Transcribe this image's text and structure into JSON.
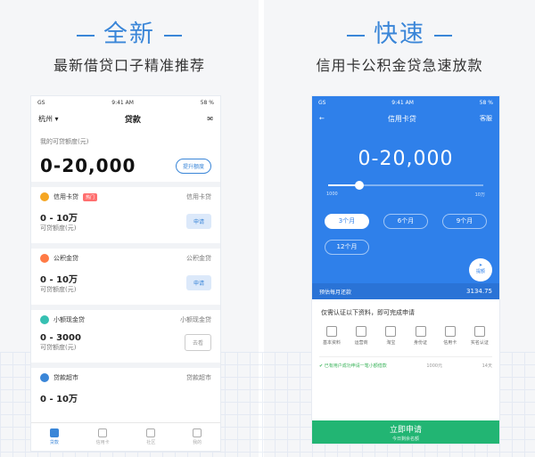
{
  "left": {
    "headline": "全新",
    "subline": "最新借贷口子精准推荐",
    "status": {
      "carrier": "GS",
      "time": "9:41 AM",
      "battery": "58 %"
    },
    "nav": {
      "city": "杭州",
      "title": "贷款"
    },
    "quota_label": "我的可贷额度(元)",
    "amount": "0-20,000",
    "boost_btn": "提升额度",
    "cards": [
      {
        "name": "信用卡贷",
        "badge": "热门",
        "right": "信用卡贷",
        "amount": "0 - 10万",
        "sub": "可贷额度(元)",
        "btn": "申请",
        "icon_color": "#f5a623"
      },
      {
        "name": "公积金贷",
        "badge": "",
        "right": "公积金贷",
        "amount": "0 - 10万",
        "sub": "可贷额度(元)",
        "btn": "申请",
        "icon_color": "#ff7a45"
      },
      {
        "name": "小额现金贷",
        "badge": "",
        "right": "小额现金贷",
        "amount": "0 - 3000",
        "sub": "可贷额度(元)",
        "btn": "去看",
        "icon_color": "#36c0b2"
      },
      {
        "name": "贷款超市",
        "badge": "",
        "right": "贷款超市",
        "amount": "0 - 10万",
        "sub": "",
        "btn": "",
        "icon_color": "#3a86d8"
      }
    ],
    "tabs": [
      "贷款",
      "信用卡",
      "社区",
      "我的"
    ]
  },
  "right": {
    "headline": "快速",
    "subline": "信用卡公积金贷急速放款",
    "status": {
      "carrier": "GS",
      "time": "9:41 AM",
      "battery": "58 %"
    },
    "nav": {
      "back": "←",
      "title": "信用卡贷",
      "action": "客服"
    },
    "amount": "0-20,000",
    "slider": {
      "value_fraction": 0.2,
      "min_label": "1000",
      "max_label": "10万"
    },
    "terms": [
      "3个月",
      "6个月",
      "9个月",
      "12个月"
    ],
    "selected_term": 0,
    "fab_label": "提额",
    "monthly_label": "预估每月还款",
    "monthly_value": "3134.75",
    "section_title": "仅需认证以下资料，即可完成申请",
    "steps": [
      "基本资料",
      "运营商",
      "淘宝",
      "身份证",
      "信用卡",
      "实名认证"
    ],
    "notice_left": "✔ 已有用户成功申请一笔小额借款",
    "notice_mid": "1000元",
    "notice_right": "14天",
    "submit": "立即申请",
    "submit_sub": "今日剩余名额"
  }
}
